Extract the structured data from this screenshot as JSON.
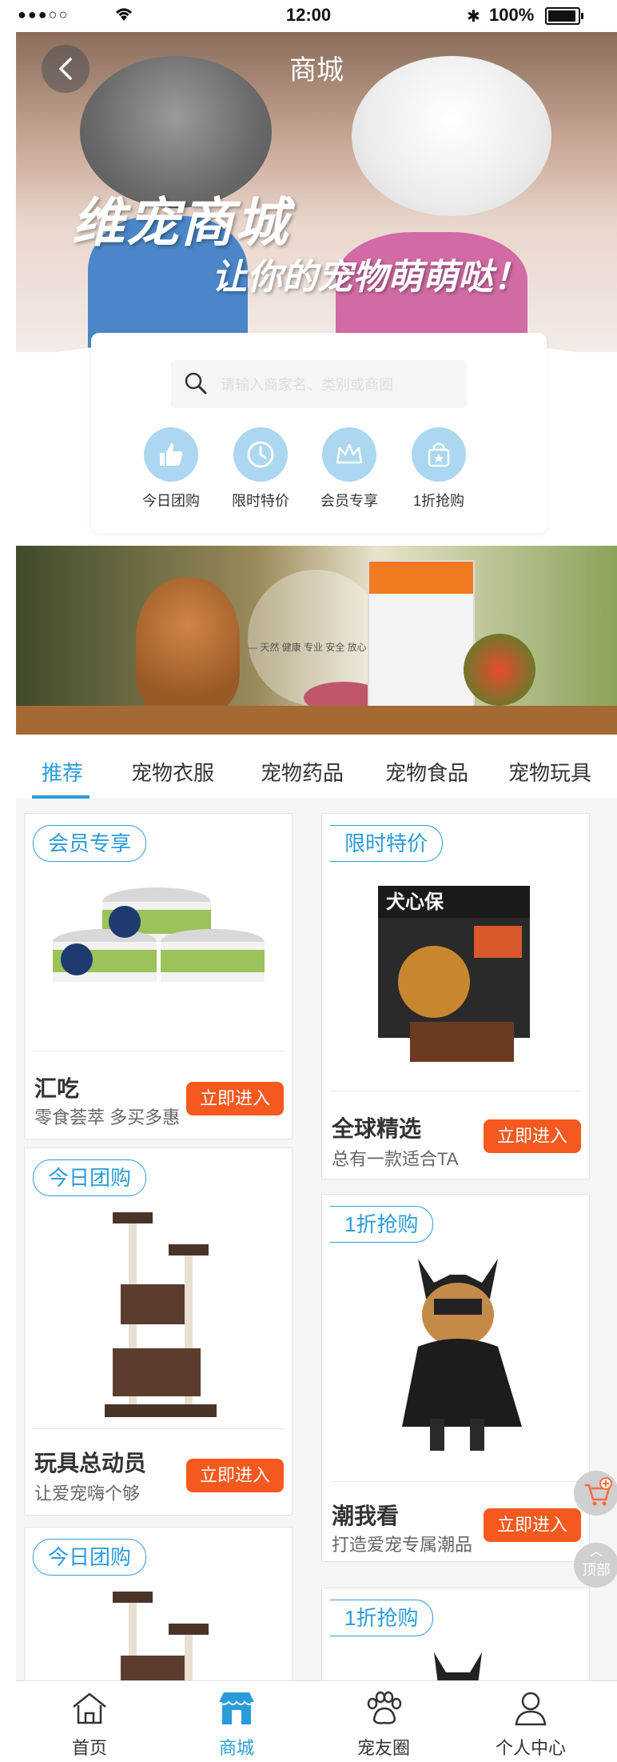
{
  "status_bar": {
    "time": "12:00",
    "battery": "100%",
    "signal": "●●●○○"
  },
  "header": {
    "title": "商城",
    "back_icon": "chevron-left-icon"
  },
  "hero": {
    "slogan": "维宠商城",
    "subslogan": "让你的宠物萌萌哒！"
  },
  "search": {
    "placeholder": "请输入商家名、类别或商圈",
    "icon": "search-icon"
  },
  "quick_links": [
    {
      "label": "今日团购",
      "icon": "thumbs-up-icon"
    },
    {
      "label": "限时特价",
      "icon": "clock-icon"
    },
    {
      "label": "会员专享",
      "icon": "crown-icon"
    },
    {
      "label": "1折抢购",
      "icon": "shopping-bag-icon"
    }
  ],
  "banner": {
    "tagline": "— 天然 健康 专业 安全 放心 —"
  },
  "tabs": [
    {
      "label": "推荐",
      "active": true
    },
    {
      "label": "宠物衣服"
    },
    {
      "label": "宠物药品"
    },
    {
      "label": "宠物食品"
    },
    {
      "label": "宠物玩具"
    }
  ],
  "products": [
    {
      "badge": "会员专享",
      "name": "汇吃",
      "desc": "零食荟萃 多买多惠",
      "button": "立即进入"
    },
    {
      "badge": "限时特价",
      "name": "全球精选",
      "desc": "总有一款适合TA",
      "button": "立即进入"
    },
    {
      "badge": "今日团购",
      "name": "玩具总动员",
      "desc": "让爱宠嗨个够",
      "button": "立即进入"
    },
    {
      "badge": "1折抢购",
      "name": "潮我看",
      "desc": "打造爱宠专属潮品",
      "button": "立即进入"
    },
    {
      "badge": "今日团购"
    },
    {
      "badge": "1折抢购"
    }
  ],
  "floating": {
    "cart_icon": "cart-plus-icon",
    "top_label": "顶部"
  },
  "bottom_nav": [
    {
      "label": "首页",
      "icon": "home-icon"
    },
    {
      "label": "商城",
      "icon": "store-icon",
      "active": true
    },
    {
      "label": "宠友圈",
      "icon": "paw-icon"
    },
    {
      "label": "个人中心",
      "icon": "user-icon"
    }
  ],
  "colors": {
    "accent": "#2a9cda",
    "button": "#f5591f",
    "icon_bg": "#abd7f0",
    "text": "#333333",
    "subtext": "#666666",
    "placeholder": "#dddddd"
  }
}
